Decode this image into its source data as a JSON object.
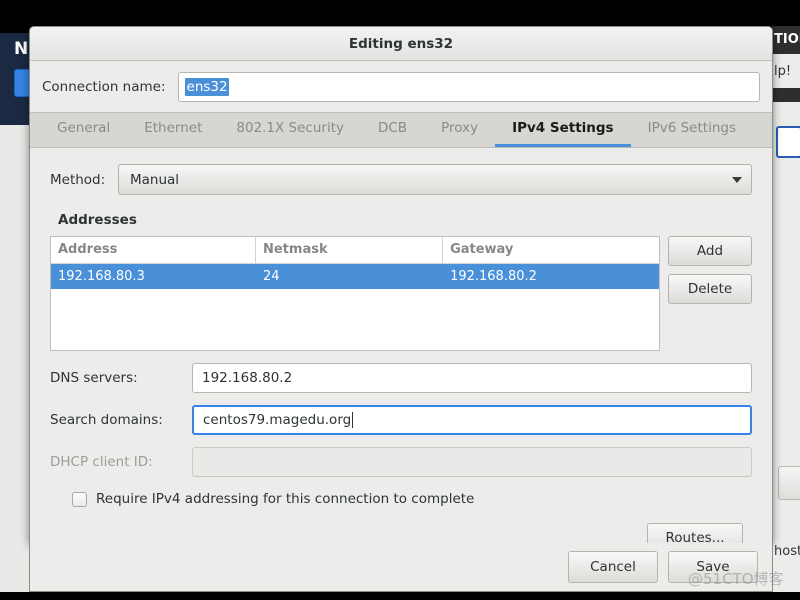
{
  "background": {
    "left_window_title": "N",
    "right_window_header": "TION",
    "right_window_help": "lp!",
    "right_window_host": "host"
  },
  "dialog": {
    "title": "Editing ens32",
    "connection_name": {
      "label": "Connection name:",
      "value": "ens32"
    },
    "tabs": [
      {
        "label": "General",
        "active": false
      },
      {
        "label": "Ethernet",
        "active": false
      },
      {
        "label": "802.1X Security",
        "active": false
      },
      {
        "label": "DCB",
        "active": false
      },
      {
        "label": "Proxy",
        "active": false
      },
      {
        "label": "IPv4 Settings",
        "active": true
      },
      {
        "label": "IPv6 Settings",
        "active": false
      }
    ],
    "method": {
      "label": "Method:",
      "value": "Manual"
    },
    "addresses": {
      "section_title": "Addresses",
      "columns": [
        "Address",
        "Netmask",
        "Gateway"
      ],
      "rows": [
        {
          "address": "192.168.80.3",
          "netmask": "24",
          "gateway": "192.168.80.2",
          "selected": true
        }
      ],
      "add_label": "Add",
      "delete_label": "Delete"
    },
    "dns_servers": {
      "label": "DNS servers:",
      "value": "192.168.80.2"
    },
    "search_domains": {
      "label": "Search domains:",
      "value": "centos79.magedu.org"
    },
    "dhcp_client_id": {
      "label": "DHCP client ID:",
      "value": "",
      "placeholder": ""
    },
    "require_ipv4": {
      "label": "Require IPv4 addressing for this connection to complete",
      "checked": false
    },
    "routes_label": "Routes...",
    "cancel_label": "Cancel",
    "save_label": "Save"
  },
  "watermark": "@51CTO博客",
  "colors": {
    "accent_blue": "#4a90d9",
    "focus_blue": "#3584e4",
    "dialog_bg": "#ececeb",
    "tabbar_bg": "#d6d6d2",
    "navy": "#1b2a42"
  }
}
